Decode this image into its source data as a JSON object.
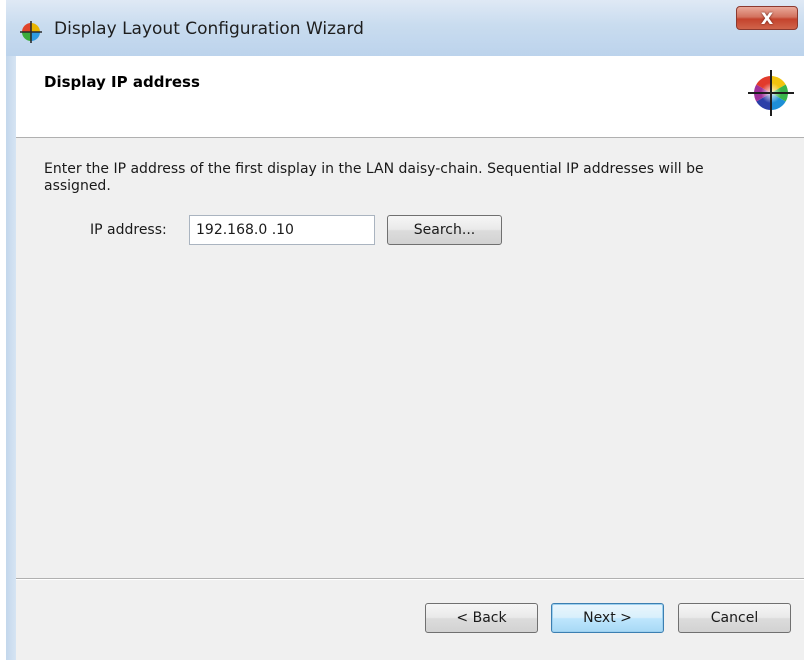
{
  "window": {
    "title": "Display Layout Configuration Wizard",
    "close_label": "X"
  },
  "header": {
    "title": "Display IP address"
  },
  "body": {
    "instructions": "Enter the IP address of the first display in the LAN daisy-chain. Sequential IP addresses will be assigned.",
    "ip_label": "IP address:",
    "ip_value": "192.168.0  .10",
    "search_label": "Search..."
  },
  "footer": {
    "back_label": "< Back",
    "next_label": "Next >",
    "cancel_label": "Cancel"
  },
  "icons": {
    "app": "color-wheel-icon",
    "header": "color-wheel-crosshair-icon",
    "close": "close-icon"
  }
}
